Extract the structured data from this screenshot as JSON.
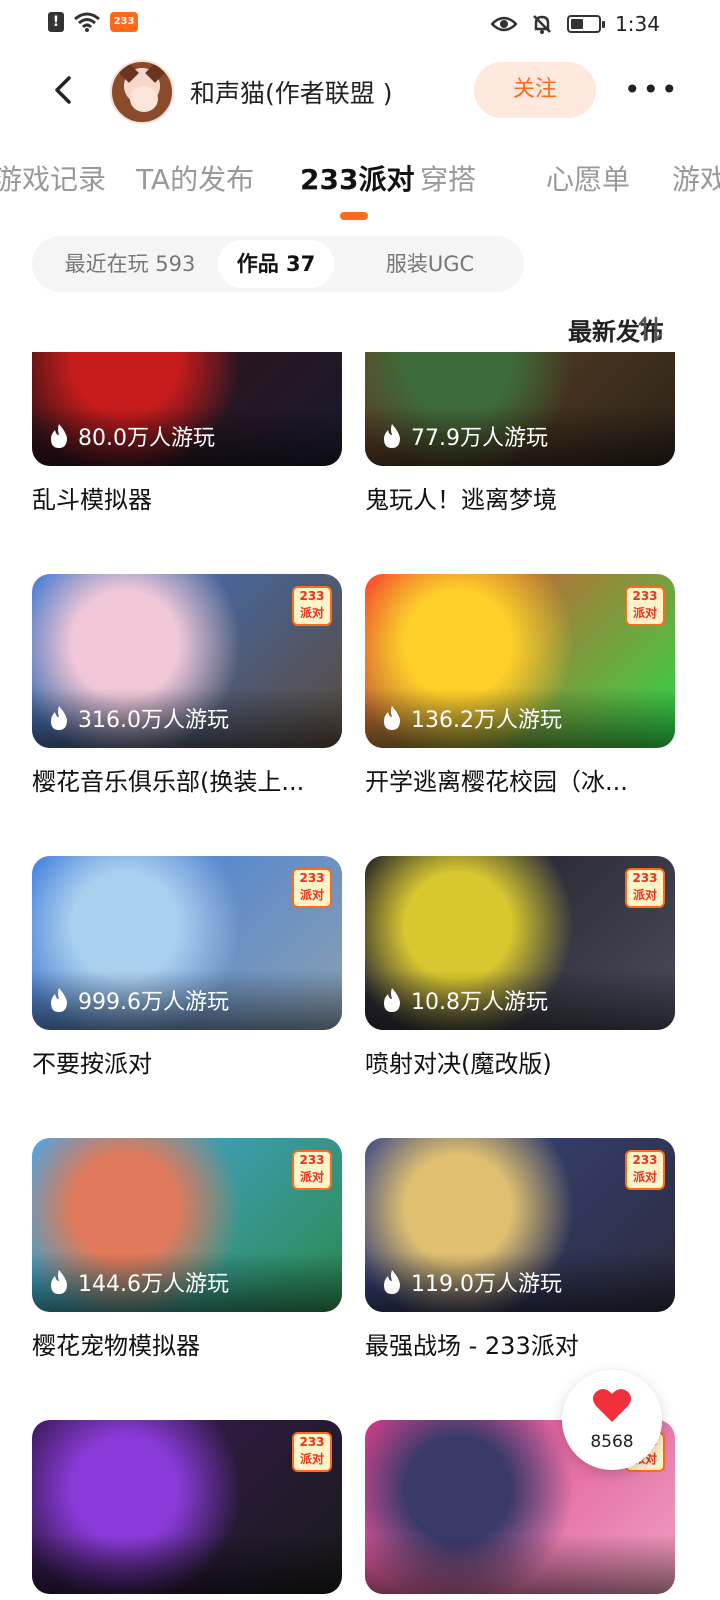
{
  "status_bar": {
    "time": "1:34",
    "app_badge": "233"
  },
  "header": {
    "username": "和声猫(作者联盟 )",
    "follow_label": "关注"
  },
  "tabs": [
    {
      "label": "游戏记录"
    },
    {
      "label": "TA的发布"
    },
    {
      "label": "233派对"
    },
    {
      "label": "穿搭"
    },
    {
      "label": "心愿单"
    },
    {
      "label": "游戏"
    }
  ],
  "filters": [
    {
      "label": "最近在玩 593"
    },
    {
      "label": "作品 37"
    },
    {
      "label": "服装UGC"
    }
  ],
  "sort_label": "最新发布",
  "badge_text": "233派对",
  "games": [
    {
      "title": "乱斗模拟器",
      "plays": "80.0万人游玩",
      "colors": [
        "#3a1010",
        "#c81c1c",
        "#1a1a2e"
      ]
    },
    {
      "title": "鬼玩人！逃离梦境",
      "plays": "77.9万人游玩",
      "colors": [
        "#6b4a2a",
        "#3e6b3a",
        "#2b2218"
      ]
    },
    {
      "title": "樱花音乐俱乐部(换装上...",
      "plays": "316.0万人游玩",
      "colors": [
        "#3a78d8",
        "#f0c8d8",
        "#5a4a3a"
      ]
    },
    {
      "title": "开学逃离樱花校园（冰...",
      "plays": "136.2万人游玩",
      "colors": [
        "#ff3a2a",
        "#ffd02a",
        "#2ad84a"
      ]
    },
    {
      "title": "不要按派对",
      "plays": "999.6万人游玩",
      "colors": [
        "#3a7ae0",
        "#aad0f0",
        "#8aa0b0"
      ]
    },
    {
      "title": "喷射对决(魔改版)",
      "plays": "10.8万人游玩",
      "colors": [
        "#1a1a24",
        "#d8c830",
        "#4a4a5a"
      ]
    },
    {
      "title": "樱花宠物模拟器",
      "plays": "144.6万人游玩",
      "colors": [
        "#4aa8f0",
        "#e07a5a",
        "#2a8a4a"
      ]
    },
    {
      "title": "最强战场 - 233派对",
      "plays": "119.0万人游玩",
      "colors": [
        "#3a4a8a",
        "#e0c070",
        "#2a2a3a"
      ]
    },
    {
      "title": "",
      "plays": "",
      "colors": [
        "#3a1a5a",
        "#8a3ad8",
        "#1a1a1a"
      ]
    },
    {
      "title": "",
      "plays": "",
      "colors": [
        "#d83a8a",
        "#3a3a6a",
        "#f0a0c0"
      ]
    }
  ],
  "like": {
    "count": "8568"
  }
}
